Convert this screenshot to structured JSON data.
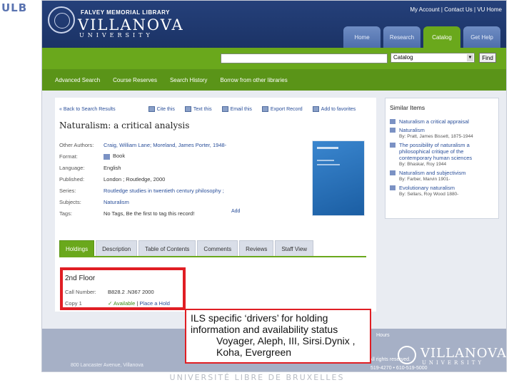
{
  "slide": {
    "logo": "ULB",
    "footer": "UNIVERSITÉ LIBRE DE BRUXELLES"
  },
  "header": {
    "library": "FALVEY MEMORIAL LIBRARY",
    "brand": "VILLANOVA",
    "brand_sub": "UNIVERSITY",
    "top_links": "My Account | Contact Us | VU Home",
    "tabs": [
      "Home",
      "Research",
      "Catalog",
      "Get Help"
    ],
    "active_tab": "Catalog"
  },
  "search": {
    "query": "",
    "scope": "Catalog",
    "find_label": "Find"
  },
  "subnav": [
    "Advanced Search",
    "Course Reserves",
    "Search History",
    "Borrow from other libraries"
  ],
  "actions": [
    "« Back to Search Results",
    "Cite this",
    "Text this",
    "Email this",
    "Export Record",
    "Add to favorites"
  ],
  "record": {
    "title": "Naturalism: a critical analysis",
    "fields": [
      {
        "label": "Other Authors:",
        "value": "Craig, William Lane; Moreland, James Porter, 1948-"
      },
      {
        "label": "Format:",
        "value": "Book"
      },
      {
        "label": "Language:",
        "value": "English"
      },
      {
        "label": "Published:",
        "value": "London ; Routledge, 2000"
      },
      {
        "label": "Series:",
        "value": "Routledge studies in twentieth century philosophy ;"
      },
      {
        "label": "Subjects:",
        "value": "Naturalism"
      },
      {
        "label": "Tags:",
        "value": "No Tags, Be the first to tag this record!"
      }
    ],
    "add_tag": "Add"
  },
  "holdings_tabs": [
    "Holdings",
    "Description",
    "Table of Contents",
    "Comments",
    "Reviews",
    "Staff View"
  ],
  "holdings": {
    "location": "2nd Floor",
    "call_label": "Call Number:",
    "call_number": "B828.2 .N367 2000",
    "copy": "Copy 1",
    "available": "Available",
    "place_hold": "Place a Hold"
  },
  "similar": {
    "title": "Similar Items",
    "items": [
      {
        "title": "Naturalism a critical appraisal",
        "by": ""
      },
      {
        "title": "Naturalism",
        "by": "By: Pratt, James Bissett, 1875-1944"
      },
      {
        "title": "The possibility of naturalism a philosophical critique of the contemporary human sciences",
        "by": "By: Bhaskar, Roy 1944"
      },
      {
        "title": "Naturalism and subjectivism",
        "by": "By: Farber, Marvin 1901-"
      },
      {
        "title": "Evolutionary naturalism",
        "by": "By: Sellars, Roy Wood 1880-"
      }
    ]
  },
  "web_footer": {
    "hours": "Hours",
    "rights": "All rights reserved.",
    "phone": "519-4270 • 610-519-5000",
    "addr": "800 Lancaster Avenue, Villanova"
  },
  "callout": {
    "line1": "ILS specific ‘drivers’ for holding information and availability status",
    "line2": "Voyager, Aleph, III, Sirsi.Dynix , Koha, Evergreen"
  },
  "colors": {
    "header_blue": "#1b3366",
    "green": "#6aa81c",
    "highlight_red": "#e01e24",
    "link_blue": "#2a4f9a"
  }
}
